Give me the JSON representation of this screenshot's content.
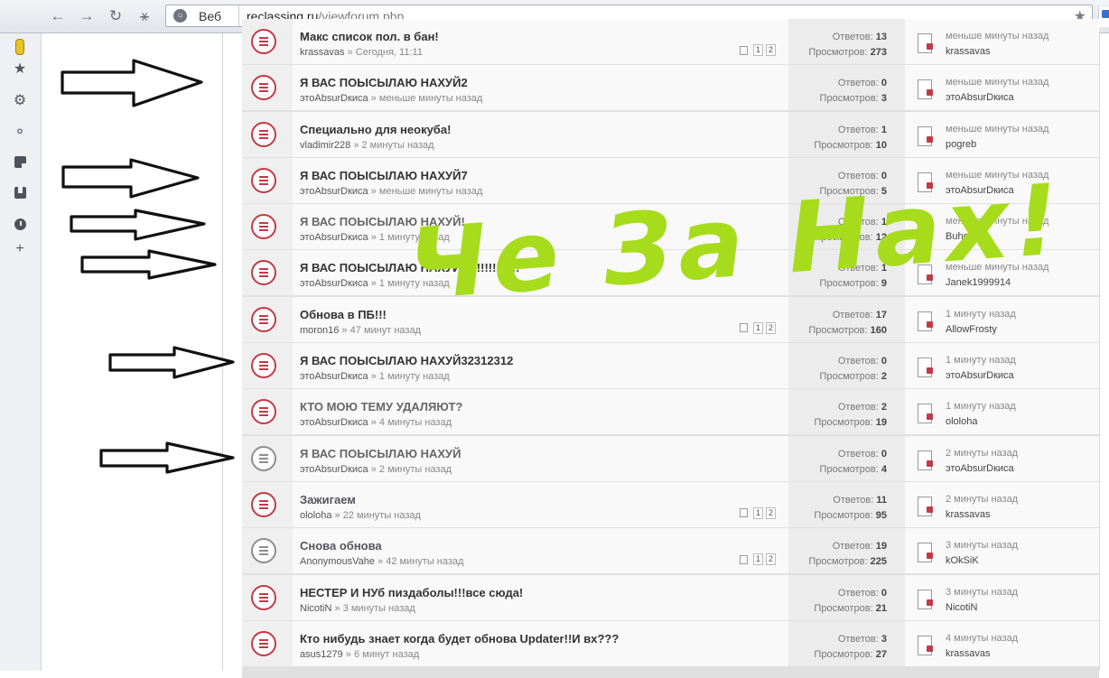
{
  "browser": {
    "mode_label": "Веб",
    "url_host": "reclassing.ru",
    "url_path": "/viewforum.php"
  },
  "colors": {
    "unread_icon": "#c23a45",
    "read_icon": "#8e8e8e",
    "overlay_text": "#a6dc1c"
  },
  "labels": {
    "replies": "Ответов:",
    "views": "Просмотров:"
  },
  "topics": [
    {
      "title": "Макс список пол. в бан!",
      "author": "krassavas",
      "time": "» Сегодня, 11:11",
      "pages": [
        "1",
        "2"
      ],
      "replies": "13",
      "views": "273",
      "last_time": "меньше минуты назад",
      "last_user": "krassavas"
    },
    {
      "title": "Я ВАС ПОЫСЫЛАЮ НАХУЙ2",
      "author": "этоAbsurDкиса",
      "time": "» меньше минуты назад",
      "replies": "0",
      "views": "3",
      "last_time": "меньше минуты назад",
      "last_user": "этоAbsurDкиса"
    },
    {
      "title": "Специально для неокуба!",
      "author": "vladimir228",
      "time": "» 2 минуты назад",
      "replies": "1",
      "views": "10",
      "last_time": "меньше минуты назад",
      "last_user": "pogreb"
    },
    {
      "title": "Я ВАС ПОЫСЫЛАЮ НАХУЙ7",
      "author": "этоAbsurDкиса",
      "time": "» меньше минуты назад",
      "replies": "0",
      "views": "5",
      "last_time": "меньше минуты назад",
      "last_user": "этоAbsurDкиса"
    },
    {
      "title": "Я ВАС ПОЫСЫЛАЮ НАХУЙ!",
      "author": "этоAbsurDкиса",
      "time": "» 1 минуту назад",
      "replies": "1",
      "views": "12",
      "last_time": "меньше минуты назад",
      "last_user": "BuhoY"
    },
    {
      "title": "Я ВАС ПОЫСЫЛАЮ НАХУЙ!!!!!!!!!!!!!!!",
      "author": "этоAbsurDкиса",
      "time": "» 1 минуту назад",
      "replies": "1",
      "views": "9",
      "last_time": "меньше минуты назад",
      "last_user": "Janek1999914"
    },
    {
      "title": "Обнова в ПБ!!!",
      "author": "moron16",
      "time": "» 47 минут назад",
      "pages": [
        "1",
        "2"
      ],
      "replies": "17",
      "views": "160",
      "last_time": "1 минуту назад",
      "last_user": "AllowFrosty"
    },
    {
      "title": "Я ВАС ПОЫСЫЛАЮ НАХУЙ32312312",
      "author": "этоAbsurDкиса",
      "time": "» 1 минуту назад",
      "replies": "0",
      "views": "2",
      "last_time": "1 минуту назад",
      "last_user": "этоAbsurDкиса"
    },
    {
      "title": "КТО МОЮ ТЕМУ УДАЛЯЮТ?",
      "author": "этоAbsurDкиса",
      "time": "» 4 минуты назад",
      "replies": "2",
      "views": "19",
      "last_time": "1 минуту назад",
      "last_user": "ololoha"
    },
    {
      "title": "Я ВАС ПОЫСЫЛАЮ НАХУЙ",
      "author": "этоAbsurDкиса",
      "time": "» 2 минуты назад",
      "replies": "0",
      "views": "4",
      "last_time": "2 минуты назад",
      "last_user": "этоAbsurDкиса"
    },
    {
      "title": "Зажигаем",
      "author": "ololoha",
      "time": "» 22 минуты назад",
      "pages": [
        "1",
        "2"
      ],
      "replies": "11",
      "views": "95",
      "last_time": "2 минуты назад",
      "last_user": "krassavas"
    },
    {
      "title": "Снова обнова",
      "author": "AnonymousVahe",
      "time": "» 42 минуты назад",
      "pages": [
        "1",
        "2"
      ],
      "replies": "19",
      "views": "225",
      "last_time": "3 минуты назад",
      "last_user": "kOkSiK"
    },
    {
      "title": "НЕСТЕР И НУб пиздаболы!!!все сюда!",
      "author": "NicotiN",
      "time": "» 3 минуты назад",
      "replies": "0",
      "views": "21",
      "last_time": "3 минуты назад",
      "last_user": "NicotiN"
    },
    {
      "title": "Кто нибудь знает когда будет обнова Updater!!И вх???",
      "author": "asus1279",
      "time": "» 6 минут назад",
      "replies": "3",
      "views": "27",
      "last_time": "4 минуты назад",
      "last_user": "krassavas"
    }
  ],
  "overlay": {
    "caption": "Че За Нах!"
  }
}
